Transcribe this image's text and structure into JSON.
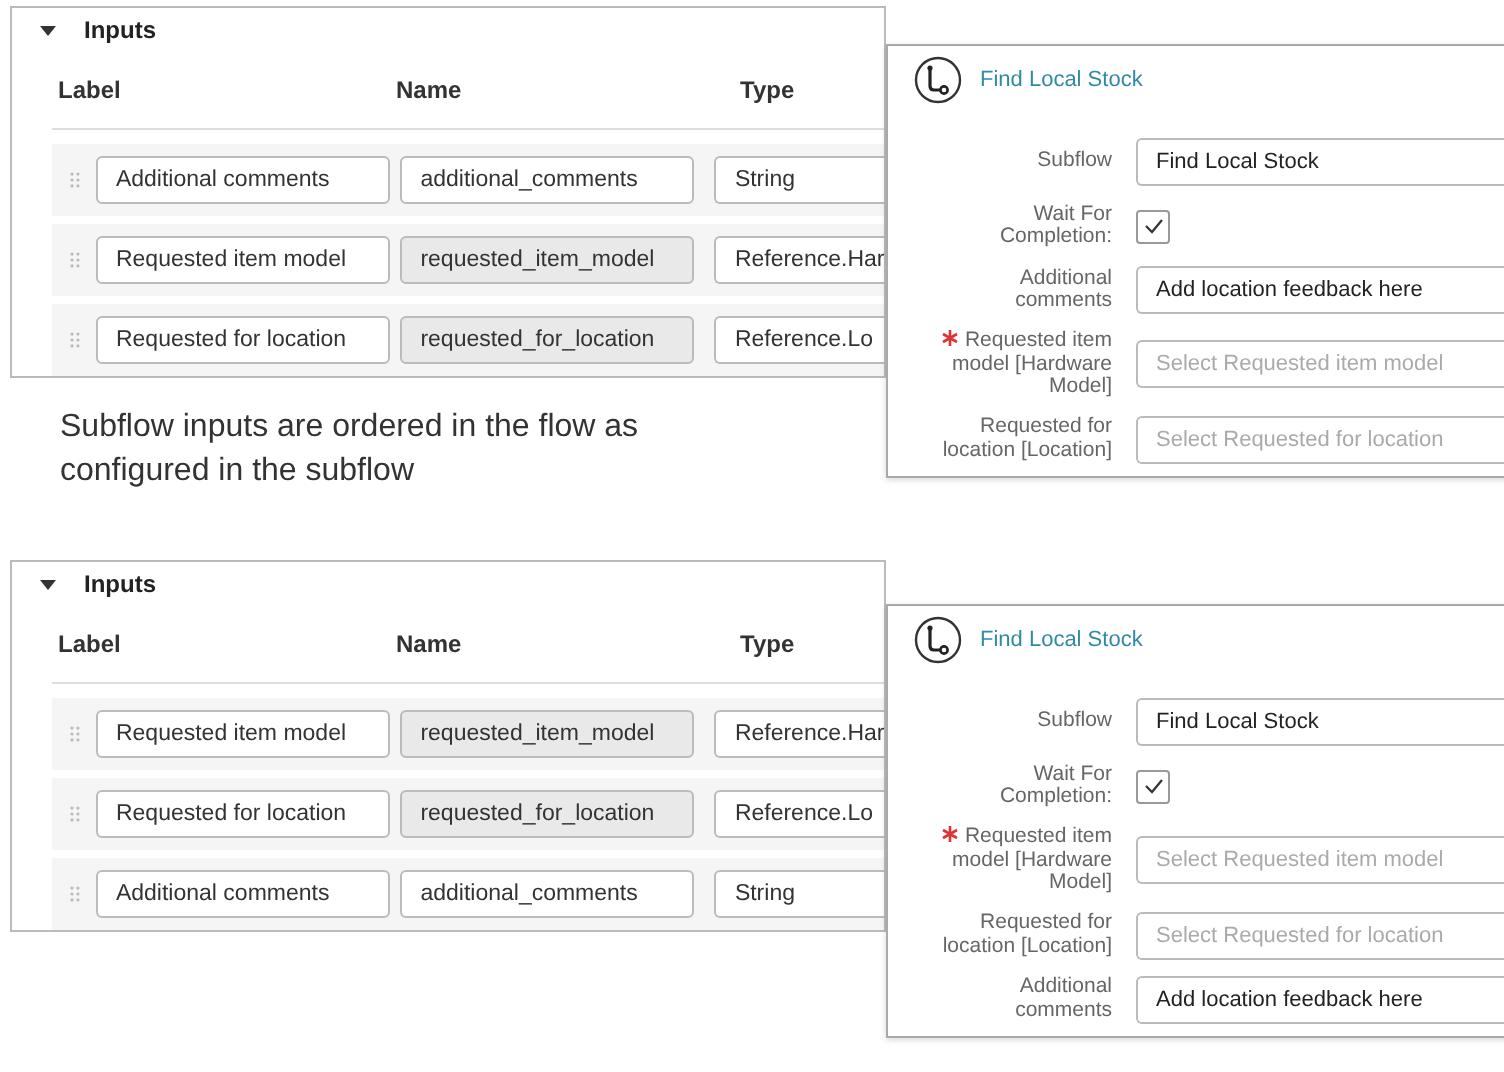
{
  "top_example": {
    "inputs_panel": {
      "title": "Inputs",
      "expanded": true,
      "columns": [
        "Label",
        "Name",
        "Type"
      ],
      "rows": [
        {
          "label": "Additional comments",
          "name": "additional_comments",
          "readonly": false,
          "type": "String"
        },
        {
          "label": "Requested item model",
          "name": "requested_item_model",
          "readonly": true,
          "type": "Reference.Har"
        },
        {
          "label": "Requested for location",
          "name": "requested_for_location",
          "readonly": true,
          "type": "Reference.Lo"
        }
      ]
    },
    "subflow_card": {
      "title": "Find Local Stock",
      "fields": [
        {
          "kind": "text",
          "label": "Subflow",
          "required": false,
          "value": "Find Local Stock"
        },
        {
          "kind": "checkbox",
          "label": "Wait For Completion:",
          "required": false,
          "checked": true
        },
        {
          "kind": "text",
          "label": "Additional comments",
          "required": false,
          "value": "Add location feedback here"
        },
        {
          "kind": "reference",
          "label": "Requested item model [Hardware Model]",
          "required": true,
          "placeholder": "Select Requested item model"
        },
        {
          "kind": "reference",
          "label": "Requested for location [Location]",
          "required": false,
          "placeholder": "Select Requested for location"
        }
      ]
    }
  },
  "caption": "Subflow inputs are ordered in the flow as configured in the subflow",
  "bottom_example": {
    "inputs_panel": {
      "title": "Inputs",
      "expanded": true,
      "columns": [
        "Label",
        "Name",
        "Type"
      ],
      "rows": [
        {
          "label": "Requested item model",
          "name": "requested_item_model",
          "readonly": true,
          "type": "Reference.Har"
        },
        {
          "label": "Requested for location",
          "name": "requested_for_location",
          "readonly": true,
          "type": "Reference.Lo"
        },
        {
          "label": "Additional comments",
          "name": "additional_comments",
          "readonly": false,
          "type": "String"
        }
      ]
    },
    "subflow_card": {
      "title": "Find Local Stock",
      "fields": [
        {
          "kind": "text",
          "label": "Subflow",
          "required": false,
          "value": "Find Local Stock"
        },
        {
          "kind": "checkbox",
          "label": "Wait For Completion:",
          "required": false,
          "checked": true
        },
        {
          "kind": "reference",
          "label": "Requested item model [Hardware Model]",
          "required": true,
          "placeholder": "Select Requested item model"
        },
        {
          "kind": "reference",
          "label": "Requested for location [Location]",
          "required": false,
          "placeholder": "Select Requested for location"
        },
        {
          "kind": "text",
          "label": "Additional comments",
          "required": false,
          "value": "Add location feedback here"
        }
      ]
    }
  }
}
